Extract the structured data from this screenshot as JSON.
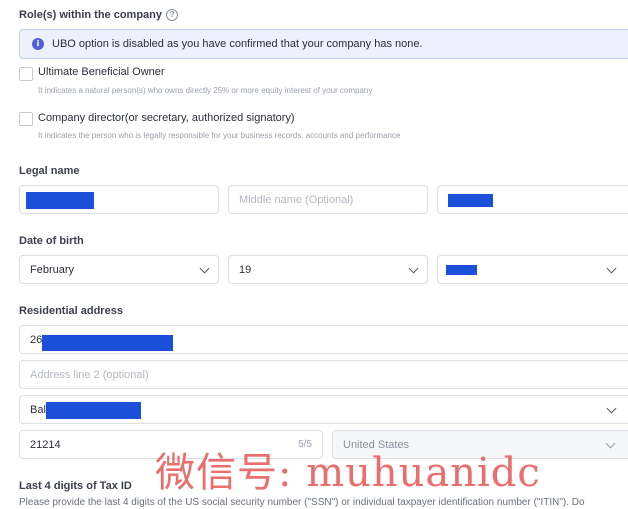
{
  "roles": {
    "label": "Role(s) within the company",
    "help_icon": "?",
    "notice": "UBO option is disabled as you have confirmed that your company has none.",
    "notice_icon": "i",
    "options": [
      {
        "title": "Ultimate Beneficial Owner",
        "desc": "It indicates a natural person(s) who owns directly 25% or more equity interest of your company"
      },
      {
        "title": "Company director(or secretary, authorized signatory)",
        "desc": "It indicates the person who is legally responsible for your business records, accounts and performance"
      }
    ]
  },
  "legal_name": {
    "label": "Legal name",
    "middle_placeholder": "Middle name (Optional)"
  },
  "dob": {
    "label": "Date of birth",
    "month": "February",
    "day": "19"
  },
  "address": {
    "label": "Residential address",
    "line1_prefix": "26",
    "line2_placeholder": "Address line 2 (optional)",
    "city_prefix": "Balt",
    "zip": "21214",
    "zip_counter": "5/5",
    "country": "United States"
  },
  "tax": {
    "label": "Last 4 digits of Tax ID",
    "desc": "Please provide the last 4 digits of the US social security number (\"SSN\") or individual taxpayer identification number (\"ITIN\"). Do"
  },
  "watermark": "微信号: muhuanidc",
  "colors": {
    "accent": "#5360d6",
    "redaction": "#1b4fd9",
    "watermark": "#e75454"
  }
}
